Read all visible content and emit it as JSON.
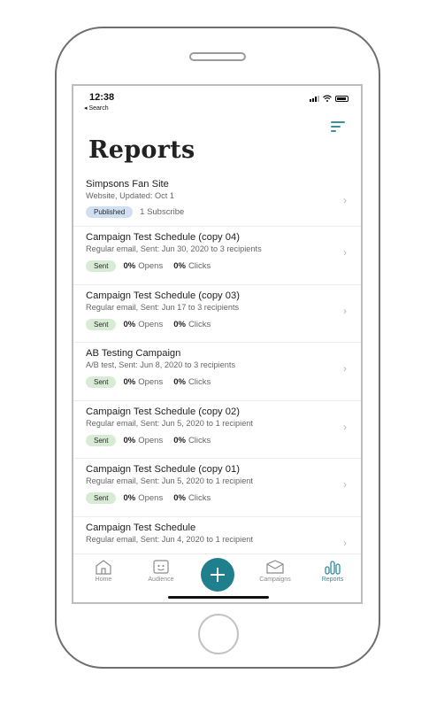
{
  "status_bar": {
    "time": "12:38",
    "back_label": "◂ Search"
  },
  "page": {
    "title": "Reports"
  },
  "reports": [
    {
      "title": "Simpsons Fan Site",
      "subtitle": "Website, Updated: Oct 1",
      "badge": "Published",
      "extra": "1 Subscribe"
    },
    {
      "title": "Campaign Test Schedule  (copy 04)",
      "subtitle": "Regular email, Sent: Jun 30, 2020 to 3 recipients",
      "badge": "Sent",
      "opens": "0%",
      "opens_label": "Opens",
      "clicks": "0%",
      "clicks_label": "Clicks"
    },
    {
      "title": "Campaign Test Schedule  (copy 03)",
      "subtitle": "Regular email, Sent: Jun 17 to 3 recipients",
      "badge": "Sent",
      "opens": "0%",
      "opens_label": "Opens",
      "clicks": "0%",
      "clicks_label": "Clicks"
    },
    {
      "title": "AB Testing Campaign",
      "subtitle": "A/B test, Sent: Jun 8, 2020 to 3 recipients",
      "badge": "Sent",
      "opens": "0%",
      "opens_label": "Opens",
      "clicks": "0%",
      "clicks_label": "Clicks"
    },
    {
      "title": "Campaign Test Schedule  (copy 02)",
      "subtitle": "Regular email, Sent: Jun 5, 2020 to 1 recipient",
      "badge": "Sent",
      "opens": "0%",
      "opens_label": "Opens",
      "clicks": "0%",
      "clicks_label": "Clicks"
    },
    {
      "title": "Campaign Test Schedule  (copy 01)",
      "subtitle": "Regular email, Sent: Jun 5, 2020 to 1 recipient",
      "badge": "Sent",
      "opens": "0%",
      "opens_label": "Opens",
      "clicks": "0%",
      "clicks_label": "Clicks"
    },
    {
      "title": "Campaign Test Schedule",
      "subtitle": "Regular email, Sent: Jun 4, 2020 to 1 recipient"
    }
  ],
  "tabbar": {
    "home": "Home",
    "audience": "Audience",
    "campaigns": "Campaigns",
    "reports": "Reports"
  },
  "colors": {
    "accent": "#1f7f8d",
    "sent_badge": "#d7ebd5",
    "published_badge": "#cfe0f2"
  }
}
